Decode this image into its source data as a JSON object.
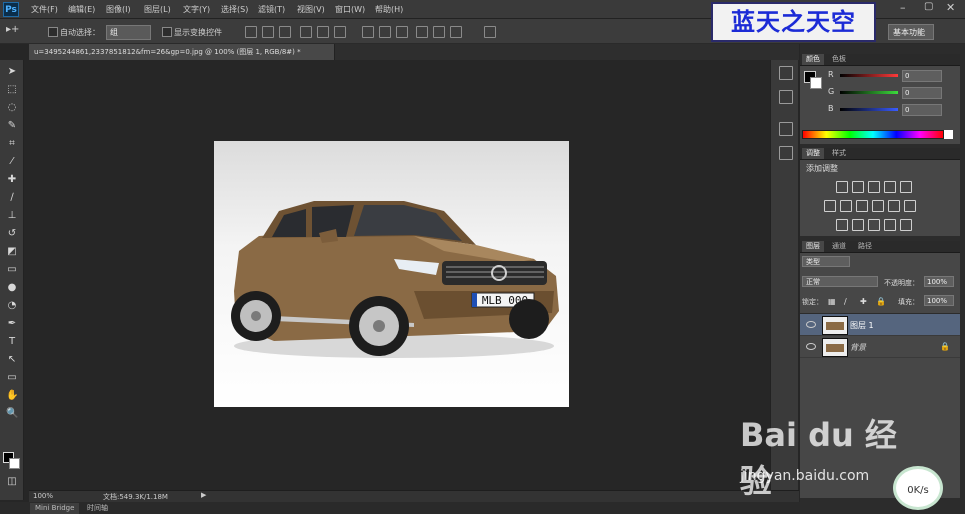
{
  "app": {
    "logo": "Ps"
  },
  "menu": [
    "文件(F)",
    "编辑(E)",
    "图像(I)",
    "图层(L)",
    "文字(Y)",
    "选择(S)",
    "滤镜(T)",
    "视图(V)",
    "窗口(W)",
    "帮助(H)"
  ],
  "options": {
    "auto_select_label": "自动选择：",
    "auto_select_value": "组",
    "show_transform_label": "显示变换控件"
  },
  "watermark_top": "蓝天之天空",
  "workspace": "基本功能",
  "document_tab": "u=3495244861,2337851812&fm=26&gp=0.jpg @ 100% (图层 1, RGB/8#) *",
  "photo": {
    "plate": "MLB 000"
  },
  "status": {
    "zoom": "100%",
    "doc_info": "文档:549.3K/1.18M"
  },
  "bottom_tabs": [
    "Mini Bridge",
    "时间轴"
  ],
  "color_panel": {
    "tabs": [
      "颜色",
      "色板"
    ],
    "channels": [
      {
        "label": "R",
        "value": "0",
        "color": "#ff3a3a"
      },
      {
        "label": "G",
        "value": "0",
        "color": "#3cdc3c"
      },
      {
        "label": "B",
        "value": "0",
        "color": "#3a5cff"
      }
    ]
  },
  "adjust_panel": {
    "tabs": [
      "调整",
      "样式"
    ],
    "title": "添加调整"
  },
  "layers_panel": {
    "tabs": [
      "图层",
      "通道",
      "路径"
    ],
    "kind": "类型",
    "blend": "正常",
    "opacity_label": "不透明度：",
    "opacity": "100%",
    "lock_label": "锁定：",
    "fill_label": "填充：",
    "fill": "100%",
    "layers": [
      {
        "name": "图层 1",
        "selected": true
      },
      {
        "name": "背景",
        "selected": false
      }
    ]
  },
  "baidu": {
    "logo": "Bai du 经验",
    "url": "jingyan.baidu.com"
  },
  "speed": "0K/s"
}
